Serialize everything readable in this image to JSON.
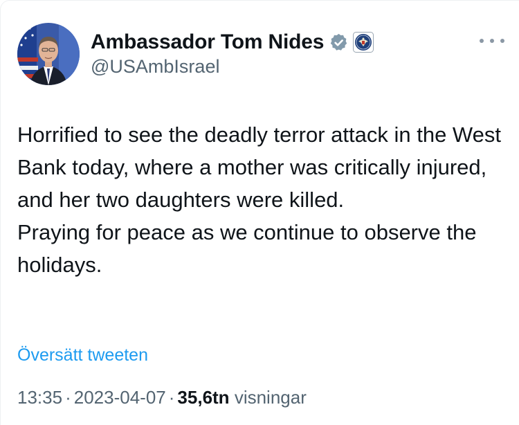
{
  "author": {
    "display_name": "Ambassador Tom Nides",
    "handle": "@USAmbIsrael",
    "avatar_icon": "profile-photo",
    "verified_icon": "verified-badge-icon",
    "affiliation_icon": "us-embassy-seal-icon"
  },
  "tweet": {
    "lines": [
      "Horrified to see the deadly terror attack in the West Bank today, where a mother was critically injured, and her two daughters were killed.",
      "Praying for peace as we continue to observe the holidays."
    ]
  },
  "translate_label": "Översätt tweeten",
  "meta": {
    "time": "13:35",
    "date": "2023-04-07",
    "views_count": "35,6tn",
    "views_label": "visningar",
    "separator": "·"
  },
  "colors": {
    "link": "#1d9bf0",
    "secondary_text": "#536471",
    "primary_text": "#0f1419"
  }
}
